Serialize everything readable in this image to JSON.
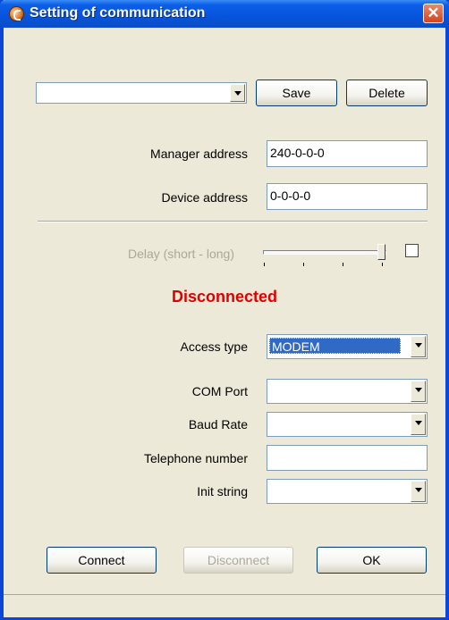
{
  "window": {
    "title": "Setting of communication",
    "app_icon": "app-logo-icon",
    "close_icon": "close-icon",
    "close_glyph": "✕"
  },
  "profile": {
    "selected": "",
    "save_label": "Save",
    "delete_label": "Delete"
  },
  "addresses": {
    "manager_label": "Manager address",
    "manager_value": "240-0-0-0",
    "device_label": "Device address",
    "device_value": "0-0-0-0"
  },
  "delay": {
    "label": "Delay (short - long)",
    "level": 1.0,
    "checked": false
  },
  "status": {
    "text": "Disconnected",
    "color": "#e00000"
  },
  "access": {
    "access_type_label": "Access type",
    "access_type_value": "MODEM",
    "com_port_label": "COM Port",
    "com_port_value": "",
    "baud_rate_label": "Baud Rate",
    "baud_rate_value": "",
    "telephone_label": "Telephone number",
    "telephone_value": "",
    "init_string_label": "Init string",
    "init_string_value": ""
  },
  "actions": {
    "connect_label": "Connect",
    "disconnect_label": "Disconnect",
    "ok_label": "OK"
  }
}
